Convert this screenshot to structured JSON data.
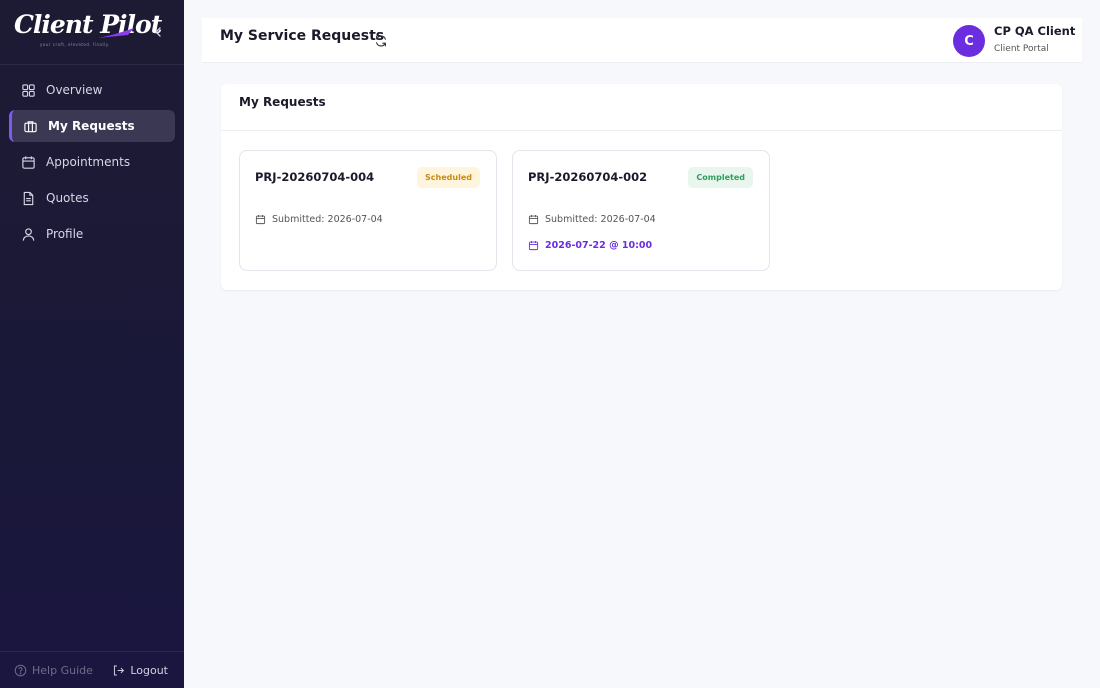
{
  "brand": {
    "logo_text": "Client Pilot",
    "tagline": "your craft, elevated. finally."
  },
  "sidebar": {
    "items": [
      {
        "label": "Overview",
        "icon": "grid-icon",
        "active": false
      },
      {
        "label": "My Requests",
        "icon": "briefcase-icon",
        "active": true
      },
      {
        "label": "Appointments",
        "icon": "calendar-icon",
        "active": false
      },
      {
        "label": "Quotes",
        "icon": "document-icon",
        "active": false
      },
      {
        "label": "Profile",
        "icon": "user-icon",
        "active": false
      }
    ],
    "help_label": "Help Guide",
    "logout_label": "Logout"
  },
  "header": {
    "title": "My Service Requests",
    "user": {
      "initial": "C",
      "name": "CP QA Client",
      "role": "Client Portal"
    }
  },
  "panel": {
    "title": "My Requests",
    "requests": [
      {
        "id": "PRJ-20260704-004",
        "status": "Scheduled",
        "submitted": "Submitted: 2026-07-04",
        "appointment": ""
      },
      {
        "id": "PRJ-20260704-002",
        "status": "Completed",
        "submitted": "Submitted: 2026-07-04",
        "appointment": "2026-07-22 @ 10:00"
      }
    ]
  },
  "colors": {
    "accent": "#6a2ee0",
    "sidebar_bg": "#1d1b33",
    "scheduled": "#c98a14",
    "completed": "#2f9e5b"
  }
}
